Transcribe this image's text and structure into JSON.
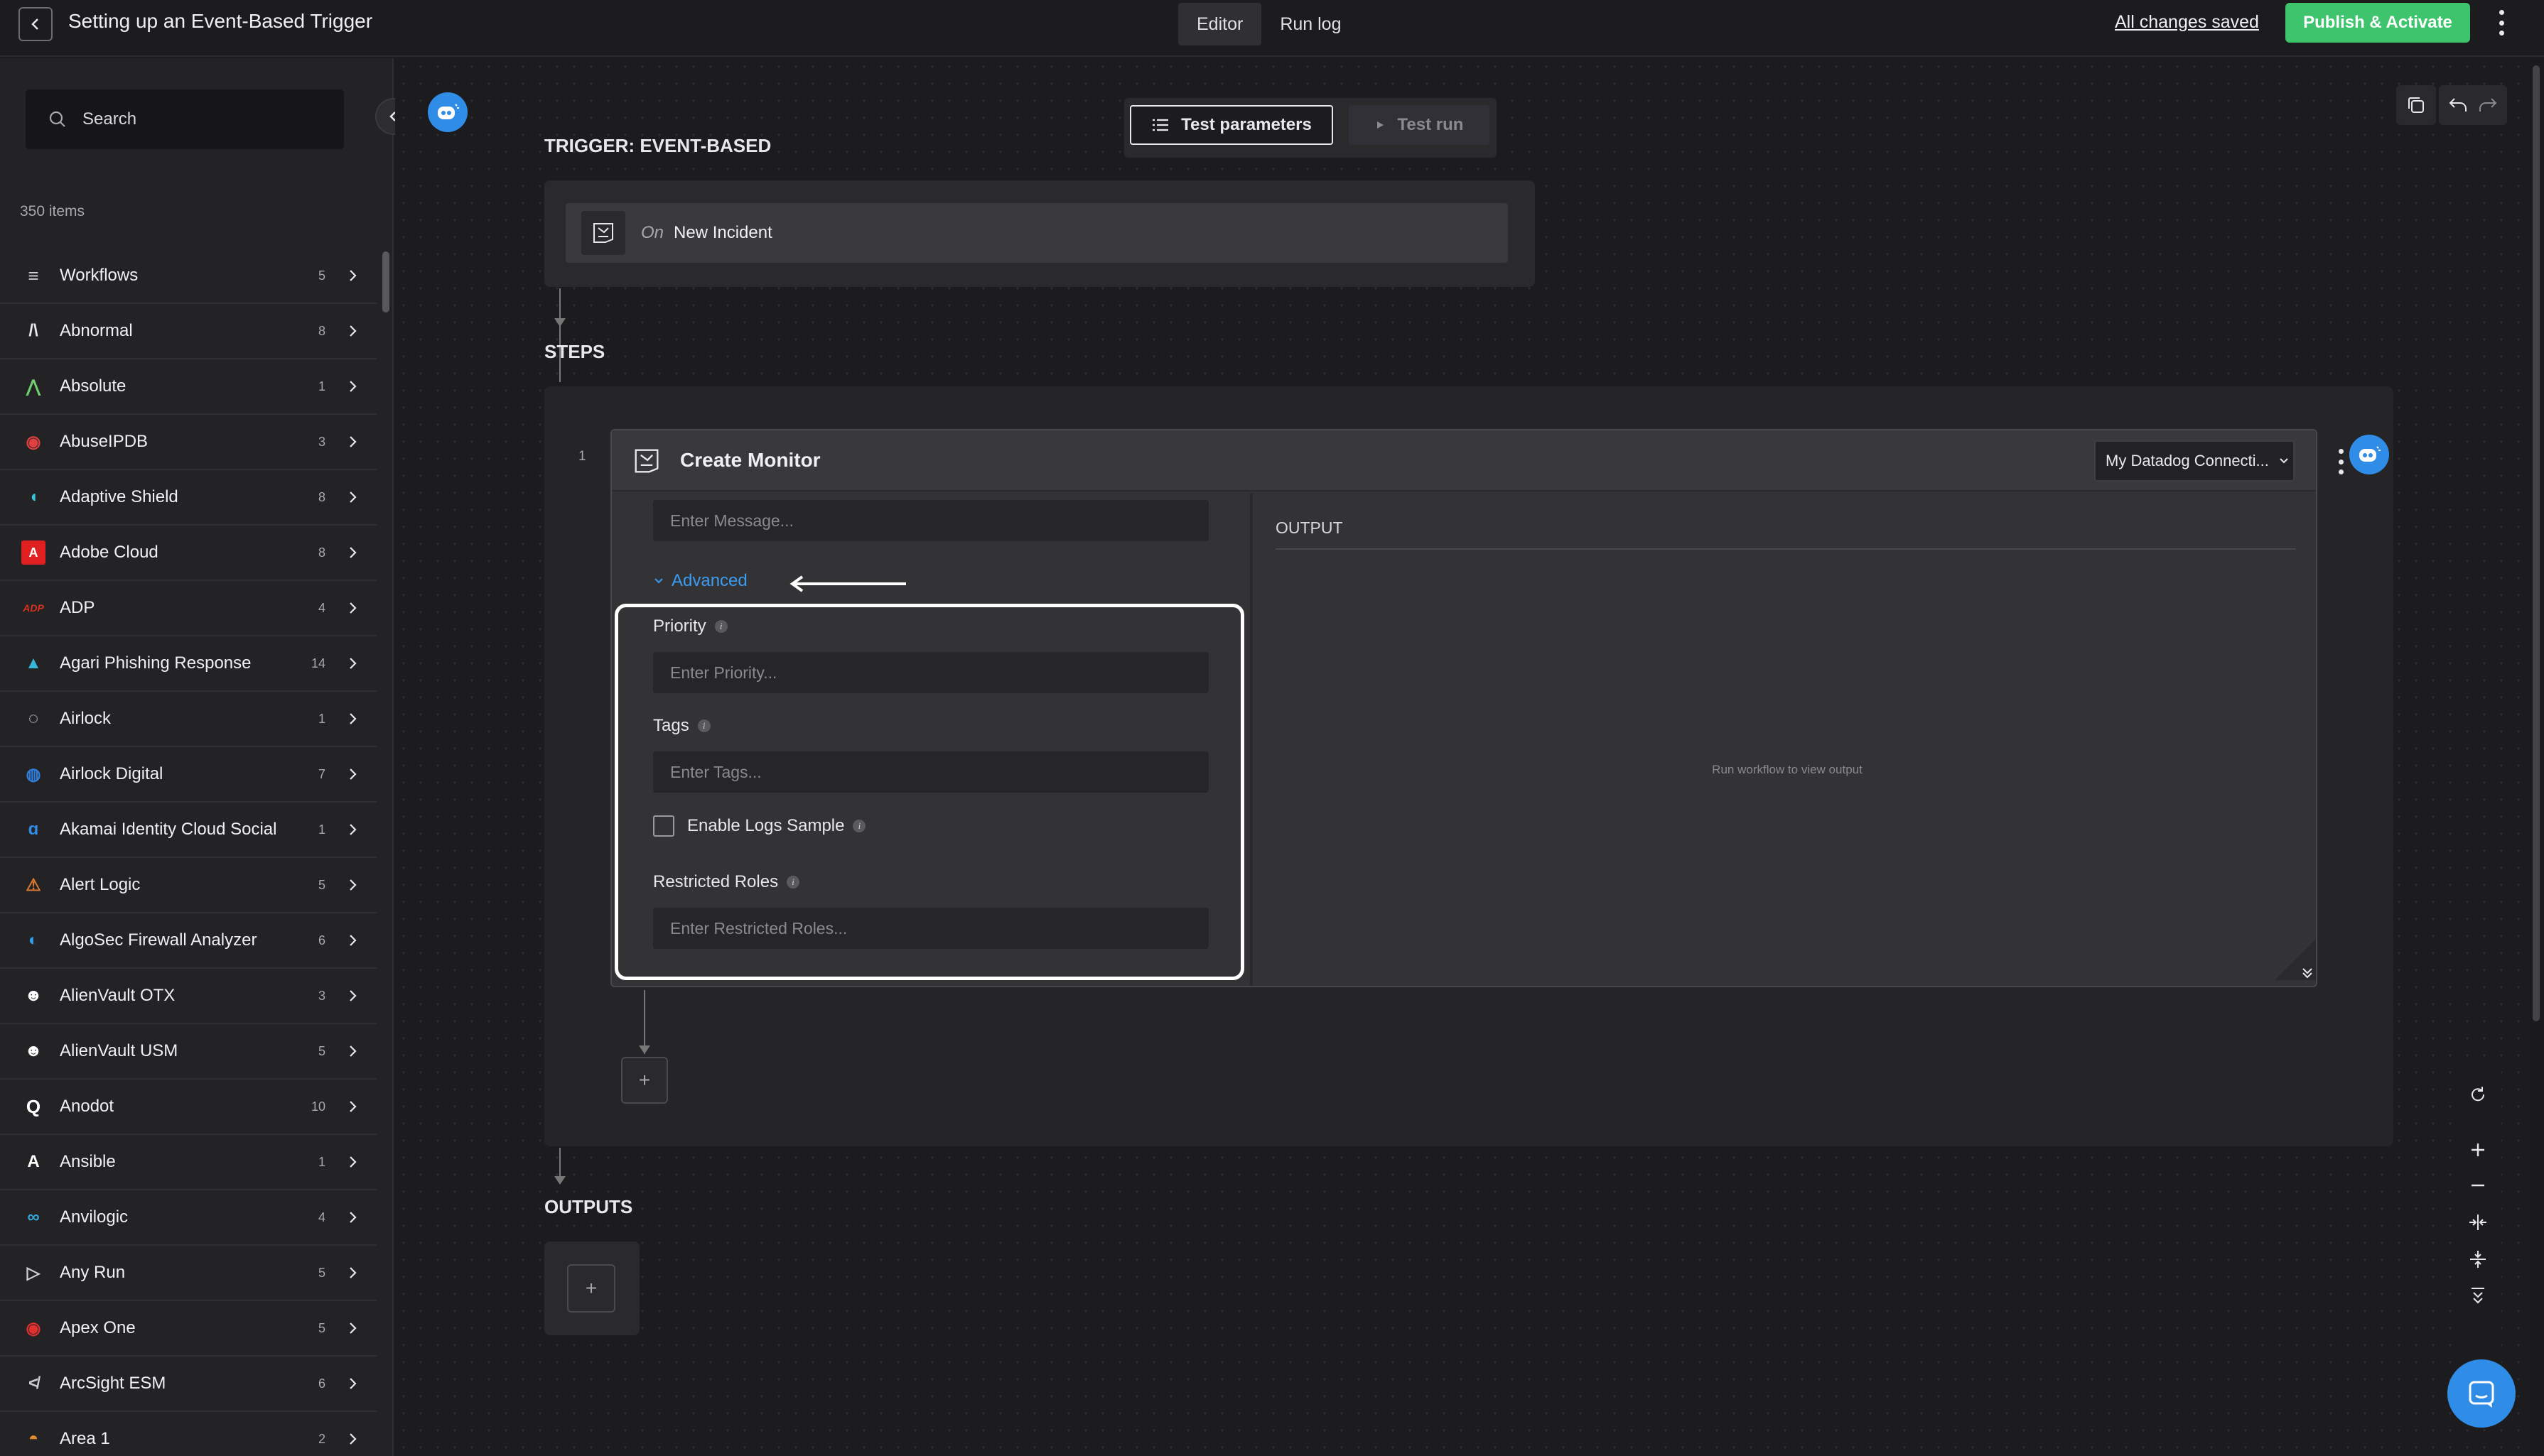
{
  "topbar": {
    "title": "Setting up an Event-Based Trigger",
    "tabs": [
      {
        "label": "Editor",
        "active": true
      },
      {
        "label": "Run log",
        "active": false
      }
    ],
    "saved_status": "All changes saved",
    "publish_label": "Publish & Activate",
    "publish_color": "#3ec46d"
  },
  "sidebar": {
    "search_placeholder": "Search",
    "item_count": "350 items",
    "items": [
      {
        "label": "Workflows",
        "count": "5",
        "icon": "workflows-icon"
      },
      {
        "label": "Abnormal",
        "count": "8",
        "icon": "abnormal-icon"
      },
      {
        "label": "Absolute",
        "count": "1",
        "icon": "absolute-icon"
      },
      {
        "label": "AbuseIPDB",
        "count": "3",
        "icon": "abuseipdb-icon"
      },
      {
        "label": "Adaptive Shield",
        "count": "8",
        "icon": "adaptive-shield-icon"
      },
      {
        "label": "Adobe Cloud",
        "count": "8",
        "icon": "adobe-icon"
      },
      {
        "label": "ADP",
        "count": "4",
        "icon": "adp-icon"
      },
      {
        "label": "Agari Phishing Response",
        "count": "14",
        "icon": "agari-icon"
      },
      {
        "label": "Airlock",
        "count": "1",
        "icon": "airlock-icon"
      },
      {
        "label": "Airlock Digital",
        "count": "7",
        "icon": "airlock-digital-icon"
      },
      {
        "label": "Akamai Identity Cloud Social",
        "count": "1",
        "icon": "akamai-icon"
      },
      {
        "label": "Alert Logic",
        "count": "5",
        "icon": "alert-logic-icon"
      },
      {
        "label": "AlgoSec Firewall Analyzer",
        "count": "6",
        "icon": "algosec-icon"
      },
      {
        "label": "AlienVault OTX",
        "count": "3",
        "icon": "alienvault-icon"
      },
      {
        "label": "AlienVault USM",
        "count": "5",
        "icon": "alienvault-icon"
      },
      {
        "label": "Anodot",
        "count": "10",
        "icon": "anodot-icon"
      },
      {
        "label": "Ansible",
        "count": "1",
        "icon": "ansible-icon"
      },
      {
        "label": "Anvilogic",
        "count": "4",
        "icon": "anvilogic-icon"
      },
      {
        "label": "Any Run",
        "count": "5",
        "icon": "any-run-icon"
      },
      {
        "label": "Apex One",
        "count": "5",
        "icon": "apex-one-icon"
      },
      {
        "label": "ArcSight ESM",
        "count": "6",
        "icon": "arcsight-icon"
      },
      {
        "label": "Area 1",
        "count": "2",
        "icon": "area1-icon"
      }
    ]
  },
  "canvas": {
    "test_parameters_label": "Test parameters",
    "test_run_label": "Test run",
    "trigger_section": "TRIGGER: EVENT-BASED",
    "trigger_prefix": "On",
    "trigger_event": "New Incident",
    "steps_section": "STEPS",
    "outputs_section": "OUTPUTS"
  },
  "step": {
    "number": "1",
    "title": "Create Monitor",
    "connection": "My Datadog Connecti...",
    "message_placeholder": "Enter Message...",
    "advanced_label": "Advanced",
    "priority_label": "Priority",
    "priority_placeholder": "Enter Priority...",
    "tags_label": "Tags",
    "tags_placeholder": "Enter Tags...",
    "logs_sample_label": "Enable Logs Sample",
    "logs_sample_checked": false,
    "restricted_roles_label": "Restricted Roles",
    "restricted_roles_placeholder": "Enter Restricted Roles...",
    "output_label": "OUTPUT",
    "output_empty": "Run workflow to view output"
  },
  "colors": {
    "accent_blue": "#2f8de8",
    "link_blue": "#3b9cf0",
    "background": "#1c1c1e"
  }
}
